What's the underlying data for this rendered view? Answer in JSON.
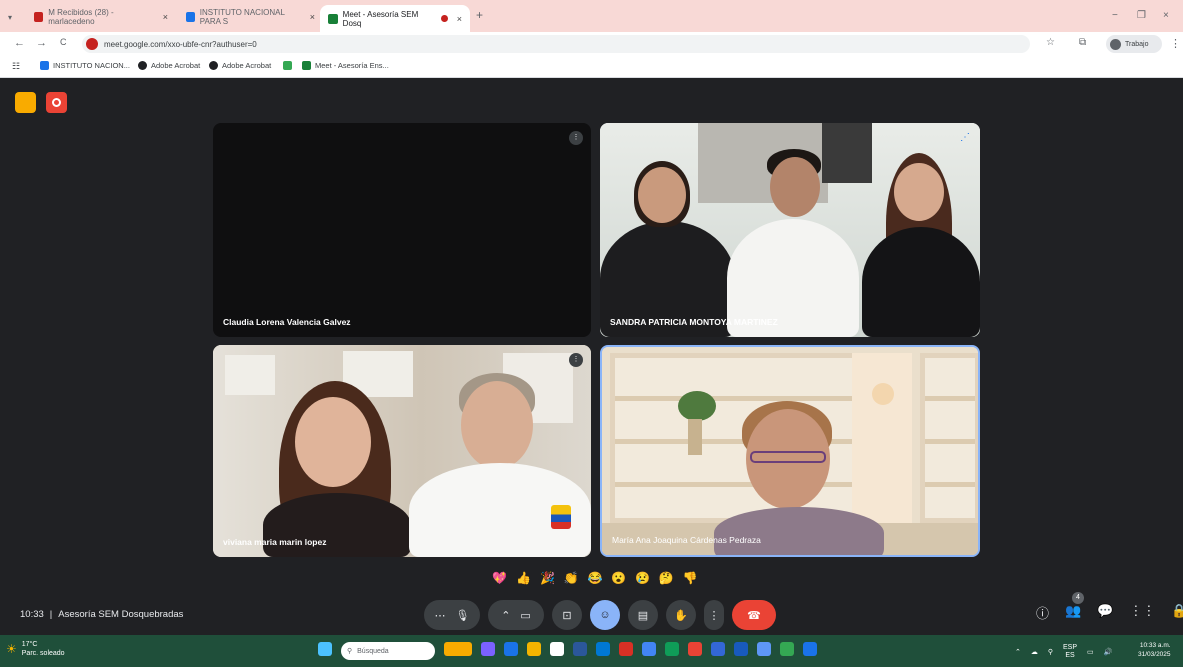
{
  "browser": {
    "tabs": [
      {
        "label": "M  Recibidos (28) - marlacedeno",
        "close": "×",
        "color": "#c5221f"
      },
      {
        "label": "INSTITUTO NACIONAL PARA S",
        "close": "×",
        "color": "#1a73e8"
      },
      {
        "label": "Meet - Asesoría SEM Dosq",
        "close": "×",
        "color": "#188038"
      }
    ],
    "new_tab": "+",
    "window_controls": {
      "minimize": "−",
      "restore": "❐",
      "close": "×"
    },
    "nav": {
      "back": "←",
      "forward": "→",
      "reload": "C"
    },
    "address": "meet.google.com/xxo-ubfe-cnr?authuser=0",
    "profile_label": "Trabajo",
    "bookmarks": [
      {
        "label": "INSTITUTO NACION...",
        "color": "#1a73e8"
      },
      {
        "label": "Adobe Acrobat",
        "color": "#202124"
      },
      {
        "label": "Adobe Acrobat",
        "color": "#202124"
      },
      {
        "label": "",
        "color": "#34a853"
      },
      {
        "label": "Meet - Asesoría Ens...",
        "color": "#188038"
      }
    ]
  },
  "meet": {
    "participants": [
      {
        "name": "Claudia Lorena Valencia Galvez"
      },
      {
        "name": "SANDRA PATRICIA MONTOYA MARTINEZ"
      },
      {
        "name": "viviana maria marin lopez"
      },
      {
        "name": "María Ana Joaquina Cárdenas Pedraza"
      }
    ],
    "reactions": [
      "💖",
      "👍",
      "🎉",
      "👏",
      "😂",
      "😮",
      "😢",
      "🤔",
      "👎"
    ],
    "time": "10:33",
    "separator": "|",
    "meeting_title": "Asesoría SEM Dosquebradas",
    "controls": {
      "more_options": "⋯",
      "mic": "🎙",
      "camera": "▭",
      "present": "⊡",
      "emoji": "☺",
      "captions": "▤",
      "raise_hand": "✋",
      "more": "⋮",
      "end_call": "☎"
    },
    "right_controls": {
      "info": "ⓘ",
      "people": "👥",
      "chat": "💬",
      "activities": "⋮⋮",
      "lock": "🔒"
    },
    "people_count": "4"
  },
  "taskbar": {
    "weather_temp": "17°C",
    "weather_desc": "Parc. soleado",
    "search_placeholder": "Búsqueda",
    "lang": "ESP",
    "lang_sub": "ES",
    "time": "10:33 a.m.",
    "date": "31/03/2025"
  },
  "colors": {
    "tabbar_bg": "#f8d9d6",
    "meet_bg": "#202124",
    "end_call": "#ea4335",
    "active_control": "#8ab4f8",
    "taskbar_bg": "#1f4f3a"
  }
}
